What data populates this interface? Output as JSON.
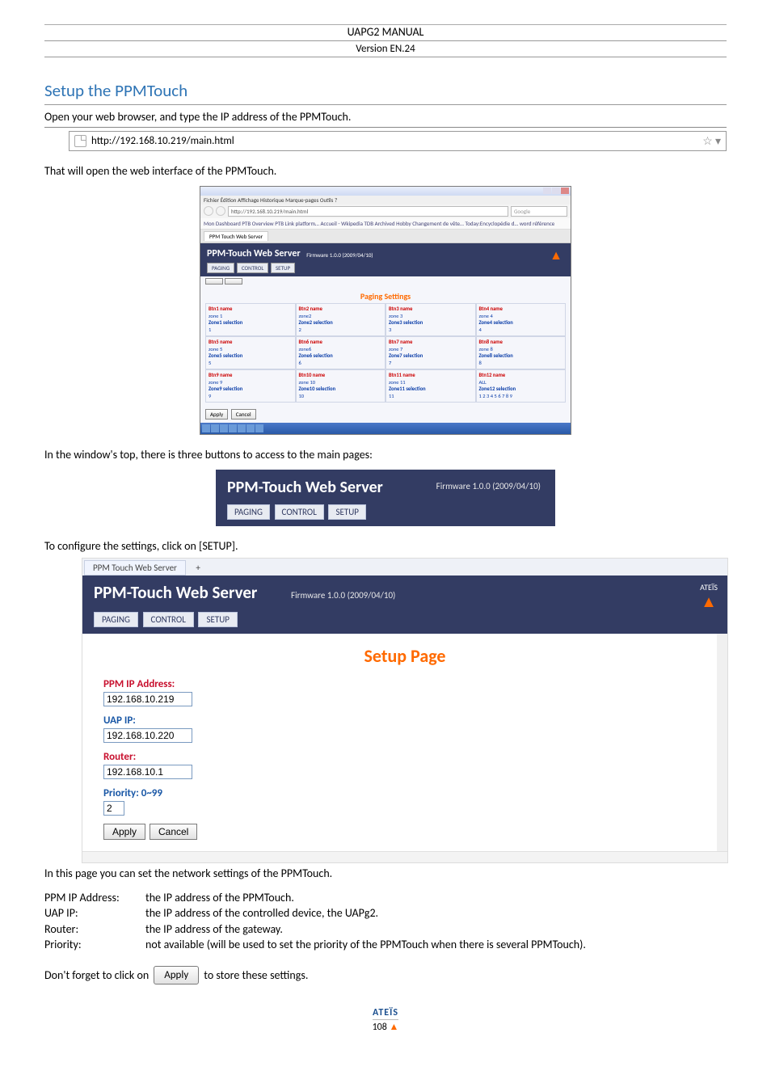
{
  "doc": {
    "header_title": "UAPG2  MANUAL",
    "version": "Version EN.24",
    "page_number": "108",
    "footer_brand": "ATEÏS"
  },
  "section": {
    "title": "Setup the PPMTouch",
    "intro": "Open your web browser, and type the IP address of the PPMTouch.",
    "after_url": "That will open the web interface of the PPMTouch.",
    "window_top_text": "In the window's top, there is three buttons to access to the main pages:",
    "configure_text": "To configure the settings, click on [SETUP].",
    "in_this_page": "In this page you can set the network settings of the PPMTouch.",
    "dont_forget_before": "Don't forget to click on",
    "dont_forget_after": "to store these settings."
  },
  "urlbar": {
    "url": "http://192.168.10.219/main.html",
    "star": "☆ ▾"
  },
  "browser_mock": {
    "menu": "Fichier  Édition  Affichage  Historique  Marque-pages  Outils  ?",
    "addr": "http://192.168.10.219/main.html",
    "search": "Google",
    "bookmarks": "Mon Dashboard  PTB Overview  PTB Link platform…  Accueil - Wkipedia  TDB  Archived  Hobby  Changement de vête…  Today:Encyclopédie d…  word référence",
    "tab": "PPM Touch Web Server",
    "apply": "Apply",
    "cancel": "Cancel"
  },
  "webserver": {
    "title": "PPM-Touch Web Server",
    "firmware": "Firmware 1.0.0 (2009/04/10)",
    "tabs": [
      "PAGING",
      "CONTROL",
      "SETUP"
    ]
  },
  "paging": {
    "title": "Paging Settings",
    "cells": [
      {
        "name": "Btn1 name",
        "val": "zone 1",
        "sel": "Zone1 selection",
        "selv": "1"
      },
      {
        "name": "Btn2 name",
        "val": "zone2",
        "sel": "Zone2 selection",
        "selv": "2"
      },
      {
        "name": "Btn3 name",
        "val": "zone 3",
        "sel": "Zone3 selection",
        "selv": "3"
      },
      {
        "name": "Btn4 name",
        "val": "zone 4",
        "sel": "Zone4 selection",
        "selv": "4"
      },
      {
        "name": "Btn5 name",
        "val": "zone 5",
        "sel": "Zone5 selection",
        "selv": "5"
      },
      {
        "name": "Btn6 name",
        "val": "zone6",
        "sel": "Zone6 selection",
        "selv": "6"
      },
      {
        "name": "Btn7 name",
        "val": "zone 7",
        "sel": "Zone7 selection",
        "selv": "7"
      },
      {
        "name": "Btn8 name",
        "val": "zone 8",
        "sel": "Zone8 selection",
        "selv": "8"
      },
      {
        "name": "Btn9 name",
        "val": "zone 9",
        "sel": "Zone9 selection",
        "selv": "9"
      },
      {
        "name": "Btn10 name",
        "val": "zone 10",
        "sel": "Zone10 selection",
        "selv": "10"
      },
      {
        "name": "Btn11 name",
        "val": "zone 11",
        "sel": "Zone11 selection",
        "selv": "11"
      },
      {
        "name": "Btn12 name",
        "val": "ALL",
        "sel": "Zone12 selection",
        "selv": "1 2 3 4 5 6 7 8 9"
      }
    ]
  },
  "setup_page": {
    "tab_title": "PPM Touch Web Server",
    "logo_text": "ATEÏS",
    "page_title": "Setup Page",
    "fields": {
      "ppm_ip_label": "PPM IP Address:",
      "ppm_ip_value": "192.168.10.219",
      "uap_ip_label": "UAP IP:",
      "uap_ip_value": "192.168.10.220",
      "router_label": "Router:",
      "router_value": "192.168.10.1",
      "priority_label": "Priority: 0~99",
      "priority_value": "2"
    },
    "buttons": {
      "apply": "Apply",
      "cancel": "Cancel"
    }
  },
  "definitions": [
    {
      "term": "PPM IP Address:",
      "desc": "the IP address of the PPMTouch."
    },
    {
      "term": "UAP IP:",
      "desc": "the IP address of the controlled device, the UAPg2."
    },
    {
      "term": "Router:",
      "desc": "the IP address of the gateway."
    },
    {
      "term": "Priority:",
      "desc": "not available (will be used to set the priority of the PPMTouch when there is several PPMTouch)."
    }
  ],
  "apply_button_label": "Apply"
}
